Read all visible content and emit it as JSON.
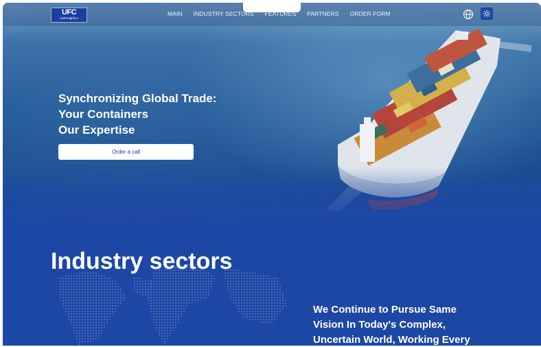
{
  "header": {
    "logo": {
      "mark": "UFC",
      "subtitle": "UniFreightCo"
    },
    "nav": [
      "MAIN",
      "INDUSTRY SECTORS",
      "FEATURES",
      "PARTNERS",
      "ORDER FORM"
    ],
    "icons": {
      "language": "globe-icon",
      "theme": "sun-icon"
    }
  },
  "hero": {
    "title_lines": [
      "Synchronizing Global Trade:",
      "Your Containers",
      "Our Expertise"
    ],
    "cta_label": "Order a call"
  },
  "industry": {
    "title": "Industry sectors",
    "vision_lines": [
      "We Continue to Pursue Same",
      "Vision In Today's Complex,",
      "Uncertain World, Working Every"
    ]
  },
  "colors": {
    "brand_blue": "#1d47a5",
    "header_overlay": "#3c6496",
    "button_bg": "#ffffff",
    "button_text": "#1b3f9c"
  }
}
